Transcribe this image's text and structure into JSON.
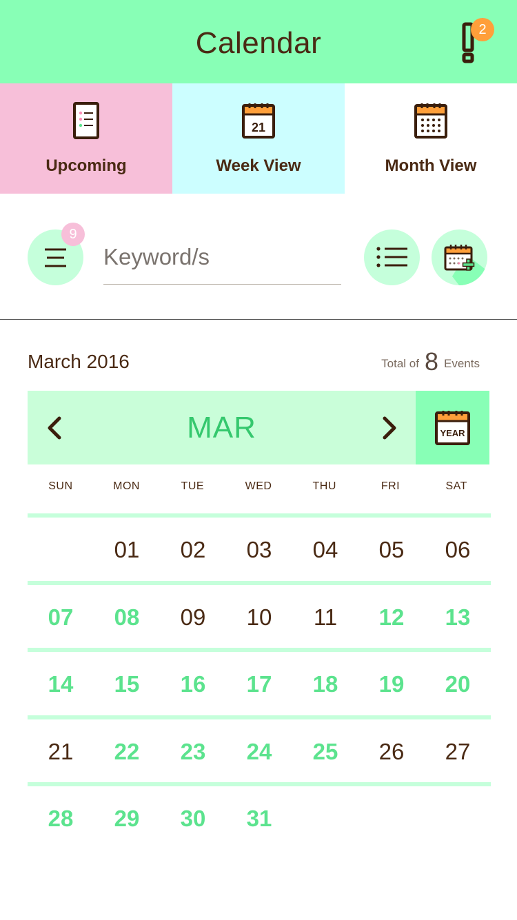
{
  "header": {
    "title": "Calendar",
    "alert_count": "2"
  },
  "tabs": [
    {
      "label": "Upcoming",
      "icon": "list-doc-icon"
    },
    {
      "label": "Week View",
      "icon": "calendar-day-icon",
      "icon_text": "21"
    },
    {
      "label": "Month View",
      "icon": "calendar-month-icon"
    }
  ],
  "toolbar": {
    "filter_count": "9",
    "search_placeholder": "Keyword/s",
    "search_value": ""
  },
  "month_header": {
    "title": "March 2016",
    "total_prefix": "Total of",
    "total_count": "8",
    "total_suffix": "Events"
  },
  "nav": {
    "month_label": "MAR",
    "year_label": "YEAR"
  },
  "weekdays": [
    "SUN",
    "MON",
    "TUE",
    "WED",
    "THU",
    "FRI",
    "SAT"
  ],
  "weeks": [
    [
      {
        "d": "",
        "e": false
      },
      {
        "d": "01",
        "e": false
      },
      {
        "d": "02",
        "e": false
      },
      {
        "d": "03",
        "e": false
      },
      {
        "d": "04",
        "e": false
      },
      {
        "d": "05",
        "e": false
      },
      {
        "d": "06",
        "e": false
      }
    ],
    [
      {
        "d": "07",
        "e": true
      },
      {
        "d": "08",
        "e": true
      },
      {
        "d": "09",
        "e": false
      },
      {
        "d": "10",
        "e": false
      },
      {
        "d": "11",
        "e": false
      },
      {
        "d": "12",
        "e": true
      },
      {
        "d": "13",
        "e": true
      }
    ],
    [
      {
        "d": "14",
        "e": true
      },
      {
        "d": "15",
        "e": true
      },
      {
        "d": "16",
        "e": true
      },
      {
        "d": "17",
        "e": true
      },
      {
        "d": "18",
        "e": true
      },
      {
        "d": "19",
        "e": true
      },
      {
        "d": "20",
        "e": true
      }
    ],
    [
      {
        "d": "21",
        "e": false
      },
      {
        "d": "22",
        "e": true
      },
      {
        "d": "23",
        "e": true
      },
      {
        "d": "24",
        "e": true
      },
      {
        "d": "25",
        "e": true
      },
      {
        "d": "26",
        "e": false
      },
      {
        "d": "27",
        "e": false
      }
    ],
    [
      {
        "d": "28",
        "e": true
      },
      {
        "d": "29",
        "e": true
      },
      {
        "d": "30",
        "e": true
      },
      {
        "d": "31",
        "e": true
      },
      {
        "d": "",
        "e": false
      },
      {
        "d": "",
        "e": false
      },
      {
        "d": "",
        "e": false
      }
    ]
  ],
  "colors": {
    "header_bg": "#88ffb6",
    "upcoming_bg": "#f7bfd9",
    "week_bg": "#ccfeff",
    "accent_green": "#5ce38e",
    "badge_orange": "#ff9f3a",
    "text_brown": "#4a2a14"
  }
}
